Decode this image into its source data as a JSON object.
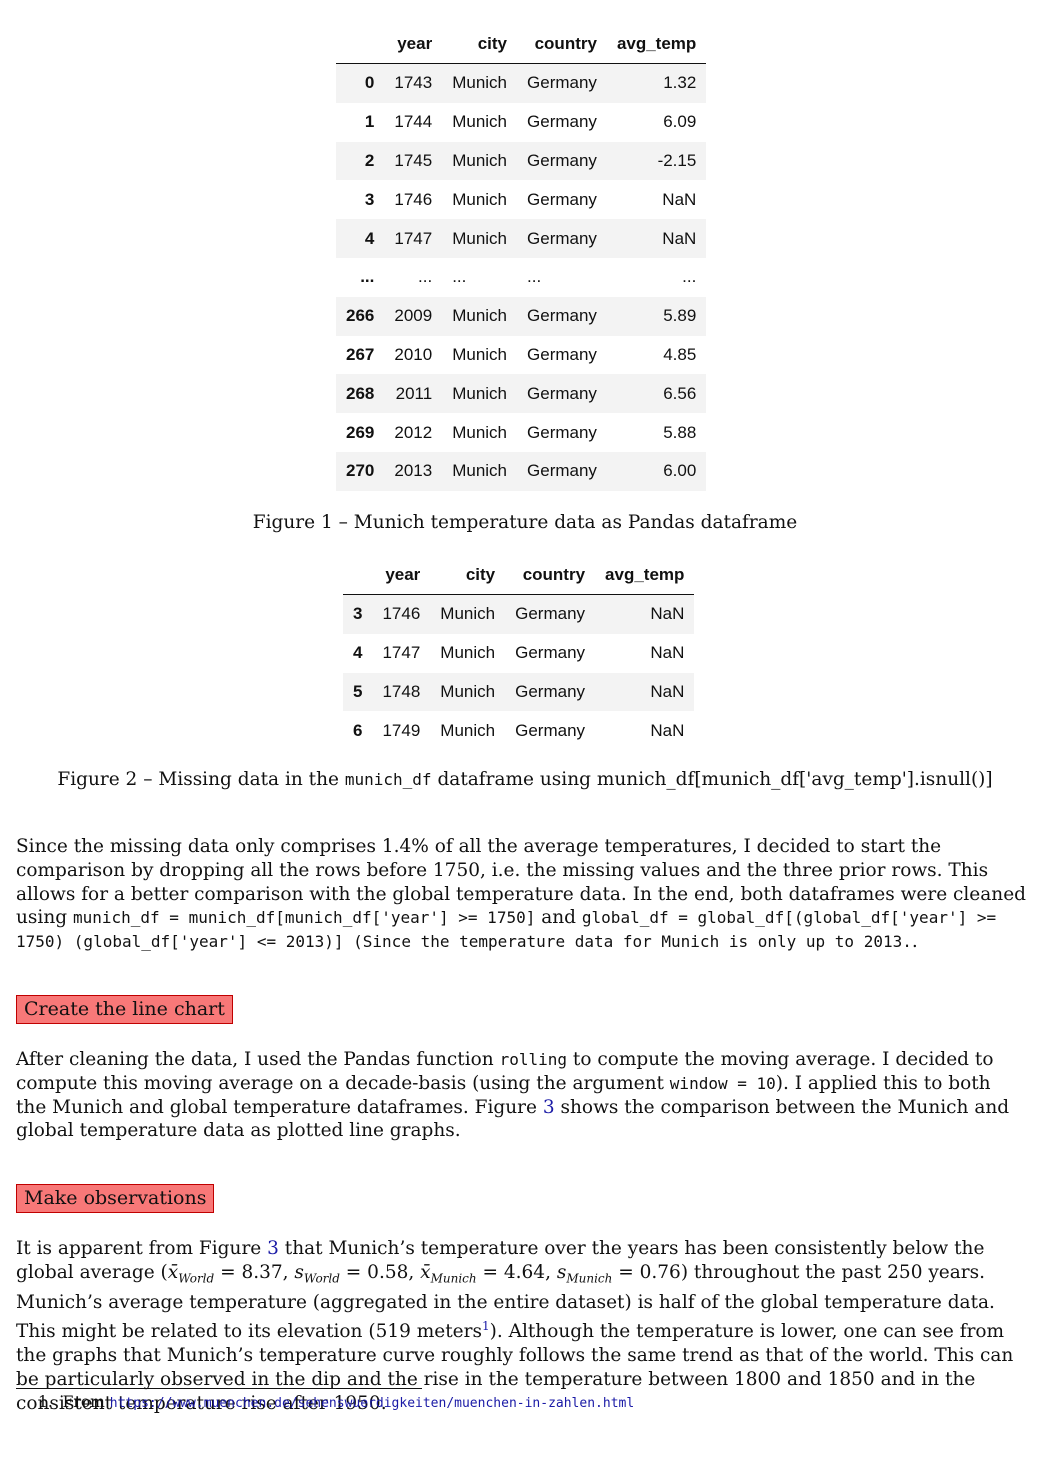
{
  "table1": {
    "headers": [
      "",
      "year",
      "city",
      "country",
      "avg_temp"
    ],
    "rows": [
      [
        "0",
        "1743",
        "Munich",
        "Germany",
        "1.32"
      ],
      [
        "1",
        "1744",
        "Munich",
        "Germany",
        "6.09"
      ],
      [
        "2",
        "1745",
        "Munich",
        "Germany",
        "-2.15"
      ],
      [
        "3",
        "1746",
        "Munich",
        "Germany",
        "NaN"
      ],
      [
        "4",
        "1747",
        "Munich",
        "Germany",
        "NaN"
      ],
      [
        "...",
        "...",
        "...",
        "...",
        "..."
      ],
      [
        "266",
        "2009",
        "Munich",
        "Germany",
        "5.89"
      ],
      [
        "267",
        "2010",
        "Munich",
        "Germany",
        "4.85"
      ],
      [
        "268",
        "2011",
        "Munich",
        "Germany",
        "6.56"
      ],
      [
        "269",
        "2012",
        "Munich",
        "Germany",
        "5.88"
      ],
      [
        "270",
        "2013",
        "Munich",
        "Germany",
        "6.00"
      ]
    ]
  },
  "caption1": "Figure 1 – Munich temperature data as Pandas dataframe",
  "table2": {
    "headers": [
      "",
      "year",
      "city",
      "country",
      "avg_temp"
    ],
    "rows": [
      [
        "3",
        "1746",
        "Munich",
        "Germany",
        "NaN"
      ],
      [
        "4",
        "1747",
        "Munich",
        "Germany",
        "NaN"
      ],
      [
        "5",
        "1748",
        "Munich",
        "Germany",
        "NaN"
      ],
      [
        "6",
        "1749",
        "Munich",
        "Germany",
        "NaN"
      ]
    ]
  },
  "caption2": {
    "prefix": "Figure 2 – Missing data in the ",
    "code": "munich_df",
    "suffix": " dataframe using munich_df[munich_df['avg_temp'].isnull()]"
  },
  "para1": {
    "text": "Since the missing data only comprises 1.4% of all the average temperatures, I decided to start the comparison by dropping all the rows before 1750, i.e. the missing values and the three prior rows. This allows for a better comparison with the global temperature data. In the end, both dataframes were cleaned using ",
    "code1": "munich_df = munich_df[munich_df['year'] >= 1750]",
    "and": " and ",
    "code2": "global_df = global_df[(global_df['year'] >= 1750) (global_df['year'] <= 2013)] (Since the temperature data for Munich is only up to 2013.",
    "end": "."
  },
  "heading1": "Create the line chart",
  "para2": {
    "t1": "After cleaning the data, I used the Pandas function ",
    "code1": "rolling",
    "t2": " to compute the moving average. I decided to compute this moving average on a decade-basis (using the argument ",
    "code2": "window = 10",
    "t3": "). I applied this to both the Munich and global temperature dataframes. Figure ",
    "ref": "3",
    "t4": " shows the comparison between the Munich and global temperature data as plotted line graphs."
  },
  "heading2": "Make observations",
  "para3": {
    "t1": "It is apparent from Figure ",
    "ref": "3",
    "t2": " that Munich’s temperature over the years has been consistently below the global average (",
    "xbar": "x̄",
    "world": "World",
    "eq_world_mean": " = 8.37, ",
    "s": "s",
    "eq_world_sd": " = 0.58, ",
    "munich": "Munich",
    "eq_munich_mean": " = 4.64, ",
    "eq_munich_sd": " = 0.76",
    "t3": ") throughout the past 250 years. Munich’s average temperature (aggregated in the entire dataset) is half of the global temperature data. This might be related to its elevation (519 meters",
    "fn": "1",
    "t4": "). Although the temperature is lower, one can see from the graphs that Munich’s temperature curve roughly follows the same trend as that of the world. This can be particularly observed in the dip and the rise in the temperature between 1800 and 1850 and in the consistent temperature rise after 1950."
  },
  "footnote": {
    "num": "1.",
    "text": "From ",
    "url": "https://www.muenchen.de/sehenswuerdigkeiten/muenchen-in-zahlen.html"
  }
}
